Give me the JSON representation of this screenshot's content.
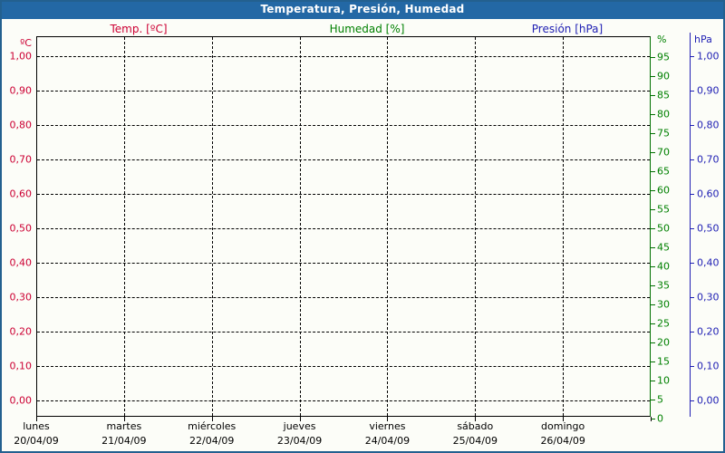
{
  "window": {
    "title": "Temperatura, Presión, Humedad"
  },
  "legend": [
    {
      "label": "Temp. [ºC]",
      "color": "#cc0033"
    },
    {
      "label": "Humedad [%]",
      "color": "#008000"
    },
    {
      "label": "Presión [hPa]",
      "color": "#2121b4"
    }
  ],
  "chart_data": {
    "type": "line",
    "title": "Temperatura, Presión, Humedad",
    "empty_plot": true,
    "series": [
      {
        "name": "Temp. [ºC]",
        "axis": "temp",
        "color": "#cc0033",
        "values": []
      },
      {
        "name": "Humedad [%]",
        "axis": "humidity",
        "color": "#008000",
        "values": []
      },
      {
        "name": "Presión [hPa]",
        "axis": "pressure",
        "color": "#2121b4",
        "values": []
      }
    ],
    "y_axes": {
      "temp": {
        "unit": "ºC",
        "side": "left",
        "color": "#cc0033",
        "min": 0.0,
        "max": 1.0,
        "step": 0.1,
        "tick_labels": [
          "1,00",
          "0,90",
          "0,80",
          "0,70",
          "0,60",
          "0,50",
          "0,40",
          "0,30",
          "0,20",
          "0,10",
          "0,00"
        ]
      },
      "humidity": {
        "unit": "%",
        "side": "right-inner",
        "color": "#008000",
        "min": 0,
        "max": 100,
        "step": 5,
        "tick_labels": [
          "95",
          "90",
          "85",
          "80",
          "75",
          "70",
          "65",
          "60",
          "55",
          "50",
          "45",
          "40",
          "35",
          "30",
          "25",
          "20",
          "15",
          "10",
          "5",
          "0"
        ]
      },
      "pressure": {
        "unit": "hPa",
        "side": "right-outer",
        "color": "#2121b4",
        "min": 0.0,
        "max": 1.0,
        "step": 0.1,
        "tick_labels": [
          "1,00",
          "0,90",
          "0,80",
          "0,70",
          "0,60",
          "0,50",
          "0,40",
          "0,30",
          "0,20",
          "0,10",
          "0,00"
        ]
      }
    },
    "x_axis": {
      "days": [
        {
          "day": "lunes",
          "date": "20/04/09"
        },
        {
          "day": "martes",
          "date": "21/04/09"
        },
        {
          "day": "miércoles",
          "date": "22/04/09"
        },
        {
          "day": "jueves",
          "date": "23/04/09"
        },
        {
          "day": "viernes",
          "date": "24/04/09"
        },
        {
          "day": "sábado",
          "date": "25/04/09"
        },
        {
          "day": "domingo",
          "date": "26/04/09"
        }
      ]
    },
    "layout_hints": {
      "grid": "dashed black, horizontal every 0.10 (left/right scales), vertical per day",
      "legend_position": "top, color-coded per series"
    }
  }
}
